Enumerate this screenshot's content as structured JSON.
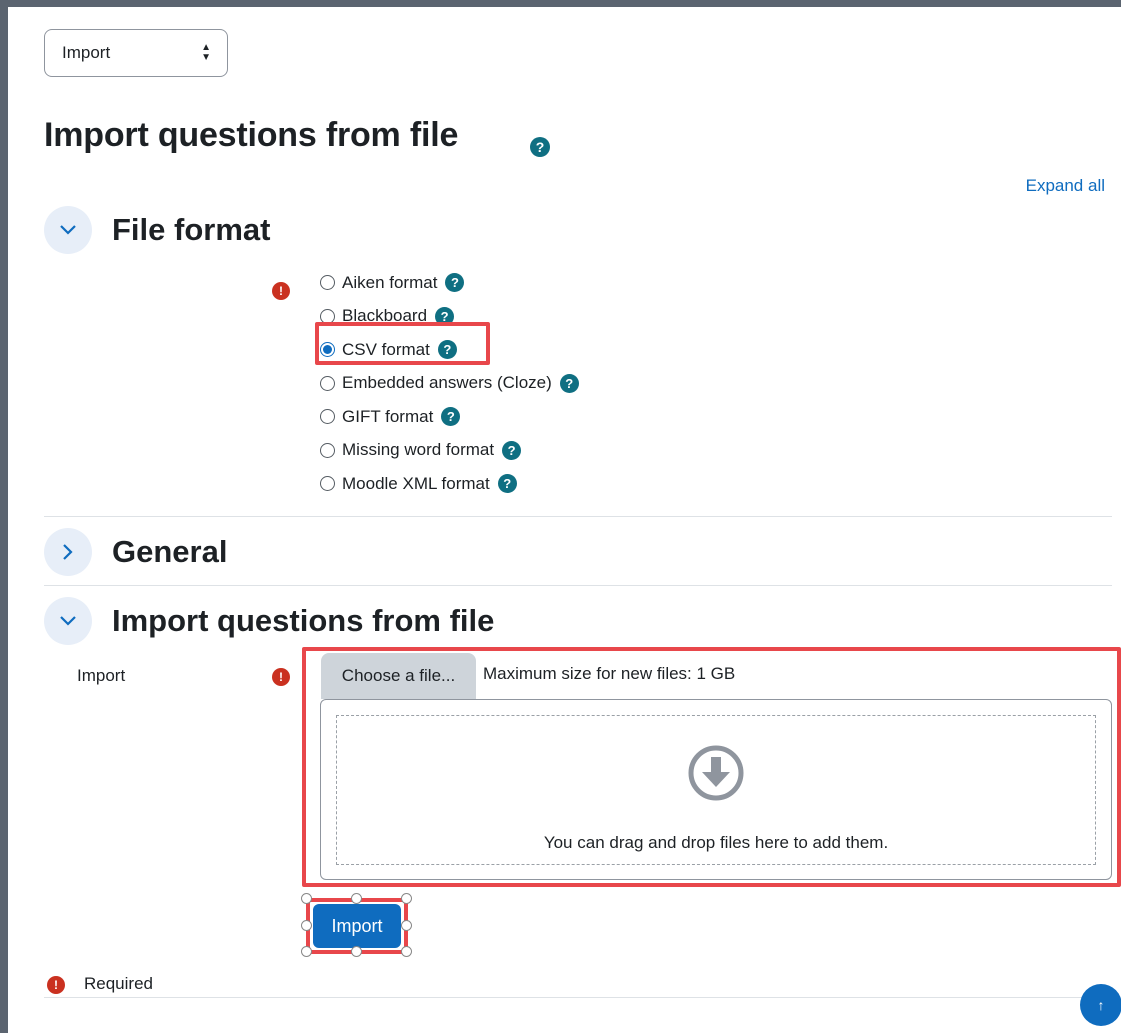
{
  "action_select": {
    "value": "Import"
  },
  "page": {
    "title": "Import questions from file"
  },
  "expand_all": "Expand all",
  "sections": {
    "file_format": {
      "title": "File format",
      "expanded": true
    },
    "general": {
      "title": "General",
      "expanded": false
    },
    "import_file": {
      "title": "Import questions from file",
      "expanded": true
    }
  },
  "formats": [
    {
      "label": "Aiken format",
      "checked": false
    },
    {
      "label": "Blackboard",
      "checked": false
    },
    {
      "label": "CSV format",
      "checked": true
    },
    {
      "label": "Embedded answers (Cloze)",
      "checked": false
    },
    {
      "label": "GIFT format",
      "checked": false
    },
    {
      "label": "Missing word format",
      "checked": false
    },
    {
      "label": "Moodle XML format",
      "checked": false
    }
  ],
  "import_field": {
    "label": "Import",
    "choose_button": "Choose a file...",
    "max_size": "Maximum size for new files: 1 GB",
    "dropzone_text": "You can drag and drop files here to add them."
  },
  "submit_button": "Import",
  "required_note": "Required",
  "icons": {
    "help": "question-circle-icon",
    "required": "exclamation-circle-icon",
    "section_toggle": "chevron-icon",
    "dropzone": "download-arrow-circle-icon",
    "back_to_top": "arrow-up-icon"
  },
  "colors": {
    "primary": "#0f6cbf",
    "help": "#0f6f82",
    "required": "#ca3120",
    "annotation": "#e8474b"
  }
}
